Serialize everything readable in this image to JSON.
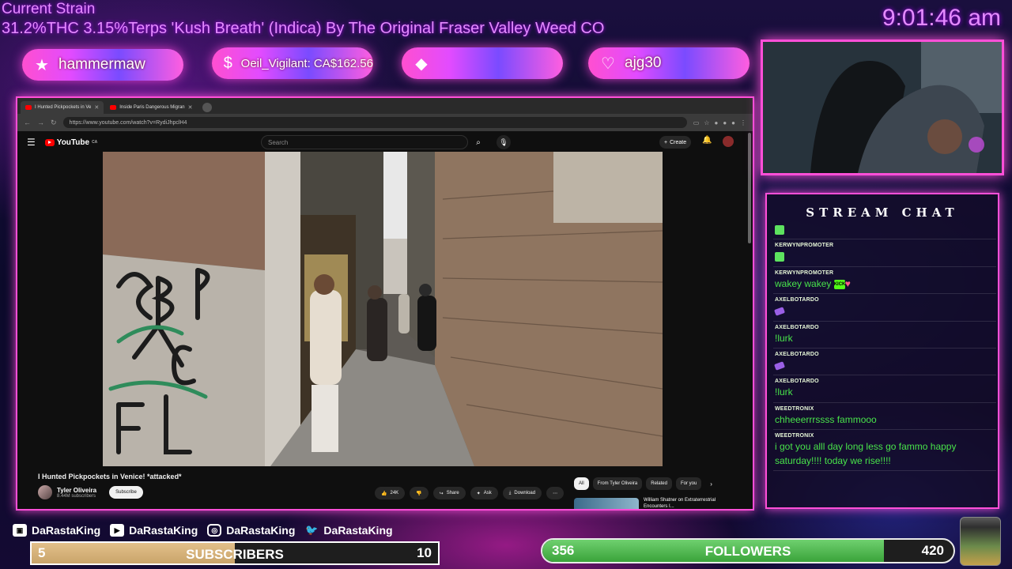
{
  "overlay": {
    "strain_title": "Current Strain",
    "strain_desc": "31.2%THC 3.15%Terps 'Kush Breath' (Indica) By The Original Fraser Valley Weed CO",
    "clock": "9:01:46 am"
  },
  "alerts": [
    {
      "icon": "star-icon",
      "text": "hammermaw"
    },
    {
      "icon": "dollar-icon",
      "text": "Oeil_Vigilant: CA$162.56"
    },
    {
      "icon": "diamond-icon",
      "text": ""
    },
    {
      "icon": "heart-icon",
      "text": "ajg30"
    }
  ],
  "browser": {
    "tabs": [
      {
        "label": "I Hunted Pickpockets in Ve",
        "active": true
      },
      {
        "label": "Inside Paris Dangerous Migran",
        "active": false
      }
    ],
    "url": "https://www.youtube.com/watch?v=RydiJhpclH4"
  },
  "youtube": {
    "logo_text": "YouTube",
    "logo_region": "CA",
    "search_placeholder": "Search",
    "create_label": "Create",
    "video_title": "I Hunted Pickpockets in Venice! *attacked*",
    "channel_name": "Tyler Oliveira",
    "channel_subs": "8.44M subscribers",
    "subscribe_label": "Subscribe",
    "like_count": "24K",
    "share_label": "Share",
    "ask_label": "Ask",
    "download_label": "Download",
    "chips": [
      "All",
      "From Tyler Oliveira",
      "Related",
      "For you"
    ],
    "rec_title": "William Shatner on Extraterrestrial Encounters I..."
  },
  "chat": {
    "title": "STREAM CHAT",
    "messages": [
      {
        "user": "",
        "text": "",
        "emote": "green"
      },
      {
        "user": "KERWYNPROMOTER",
        "text": "",
        "emote": "green"
      },
      {
        "user": "KERWYNPROMOTER",
        "text": "wakey wakey",
        "emote": "kick-heart"
      },
      {
        "user": "AXELBOTARDO",
        "text": "",
        "emote": "purple"
      },
      {
        "user": "AXELBOTARDO",
        "text": "!lurk",
        "emote": ""
      },
      {
        "user": "AXELBOTARDO",
        "text": "",
        "emote": "purple"
      },
      {
        "user": "AXELBOTARDO",
        "text": "!lurk",
        "emote": ""
      },
      {
        "user": "WEEDTRONIX",
        "text": "chheeerrrssss fammooo",
        "emote": ""
      },
      {
        "user": "WEEDTRONIX",
        "text": "i got you alll day long less go fammo happy saturday!!!! today we rise!!!!",
        "emote": ""
      }
    ]
  },
  "socials": {
    "twitch": "DaRastaKing",
    "youtube": "DaRastaKing",
    "instagram": "DaRastaKing",
    "twitter": "DaRastaKing"
  },
  "subs_goal": {
    "current": "5",
    "label": "SUBSCRIBERS",
    "target": "10",
    "progress": 0.5,
    "color": "#d9b57a"
  },
  "follow_goal": {
    "current": "356",
    "label": "FOLLOWERS",
    "target": "420",
    "progress": 0.83,
    "color": "#4fbf4f"
  },
  "colors": {
    "accent": "#ff4fd8",
    "text_purple": "#e48bff",
    "chat_green": "#48e34a"
  }
}
